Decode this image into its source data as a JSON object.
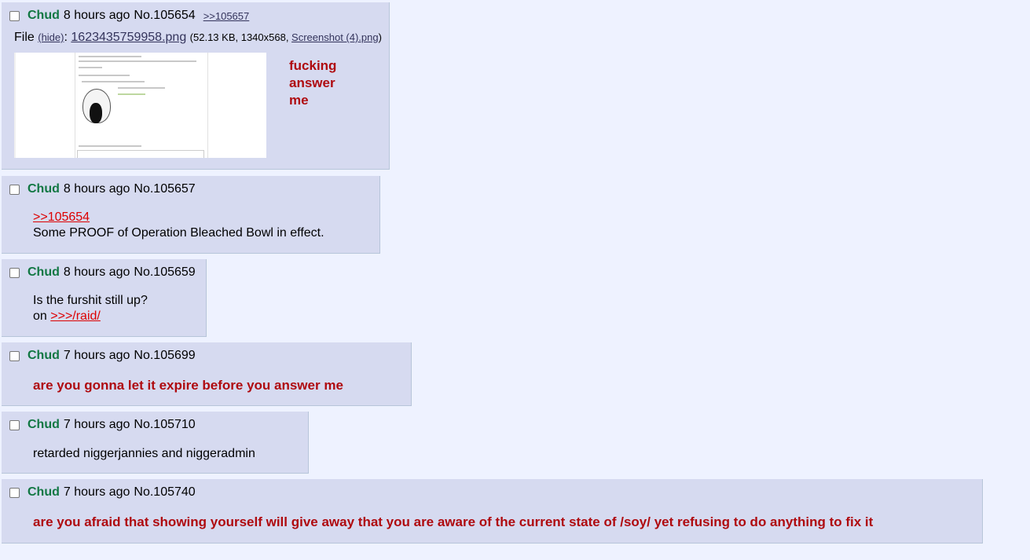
{
  "posts": [
    {
      "name": "Chud",
      "time": "8 hours ago",
      "number": "No.105654",
      "backlink": ">>105657",
      "file": {
        "prefix": "File",
        "hide": "(hide)",
        "colon": ":",
        "filename": "1623435759958.png",
        "meta_open": "(52.13 KB, 1340x568, ",
        "original": "Screenshot (4).png",
        "meta_close": ")"
      },
      "message_lines": [
        "fucking",
        "answer",
        "me"
      ]
    },
    {
      "name": "Chud",
      "time": "8 hours ago",
      "number": "No.105657",
      "quote": ">>105654",
      "message": "Some PROOF of Operation Bleached Bowl in effect."
    },
    {
      "name": "Chud",
      "time": "8 hours ago",
      "number": "No.105659",
      "message": "Is the furshit still up?",
      "on_prefix": "on ",
      "board_link": ">>>/raid/"
    },
    {
      "name": "Chud",
      "time": "7 hours ago",
      "number": "No.105699",
      "message": "are you gonna let it expire before you answer me"
    },
    {
      "name": "Chud",
      "time": "7 hours ago",
      "number": "No.105710",
      "message": "retarded niggerjannies and niggeradmin"
    },
    {
      "name": "Chud",
      "time": "7 hours ago",
      "number": "No.105740",
      "message": "are you afraid that showing yourself will give away that you are aware of the current state of /soy/ yet refusing to do anything to fix it"
    }
  ],
  "colors": {
    "page_bg": "#eef2ff",
    "post_bg": "#d6daf0",
    "name": "#117743",
    "redtext": "#af0a0f",
    "quotelink": "#dd0000",
    "link": "#34345c"
  },
  "icons": {
    "checkbox": "checkbox-icon",
    "thumbnail": "image-thumbnail"
  }
}
